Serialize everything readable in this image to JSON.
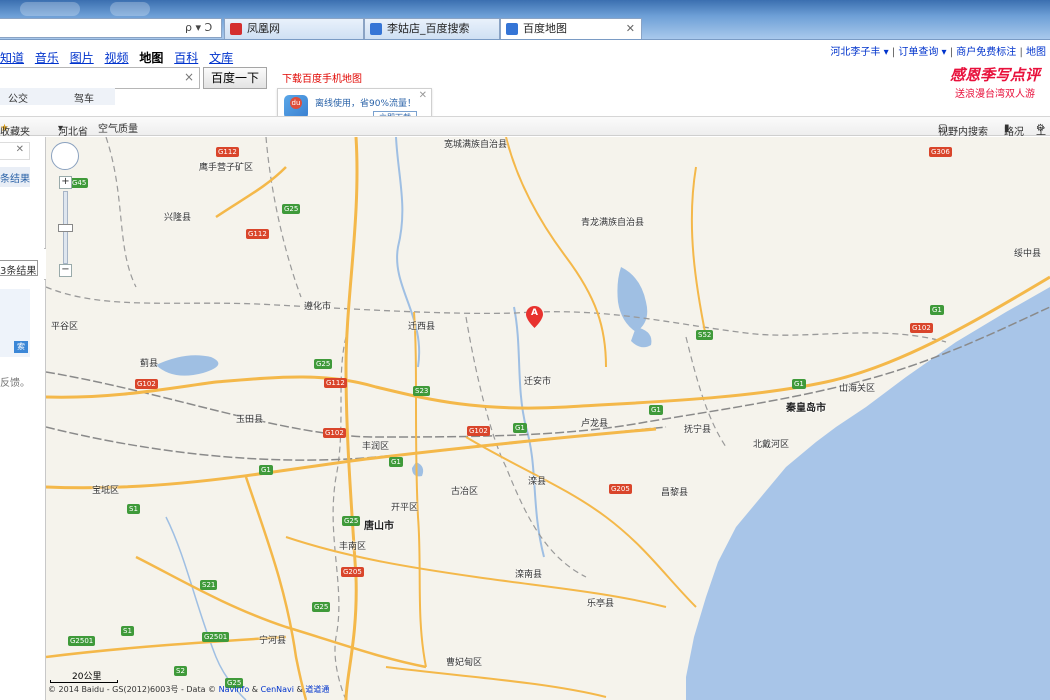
{
  "browser": {
    "address_glyphs": "ρ ▾ Ͻ",
    "tabs": [
      {
        "label": "凤凰网",
        "favicon_color": "#d42e2e"
      },
      {
        "label": "李姑店_百度搜索",
        "favicon_color": "#3575d6"
      },
      {
        "label": "百度地图",
        "favicon_color": "#3575d6"
      }
    ],
    "tab_close": "✕"
  },
  "header": {
    "nav": {
      "links": [
        "知道",
        "音乐",
        "图片",
        "视频"
      ],
      "current": "地图",
      "links_after": [
        "百科",
        "文库"
      ]
    },
    "top_right": {
      "user": "河北李子丰",
      "order": "订单查询",
      "merchant": "商户免费标注",
      "map": "地图"
    },
    "search": {
      "clear": "×",
      "button": "百度一下"
    },
    "download_mobile": "下载百度手机地图",
    "modes": [
      "公交",
      "驾车"
    ],
    "promo": {
      "badge": "du",
      "text": "离线使用，省90%流量！",
      "button": "立即下载",
      "close": "✕"
    },
    "banner": {
      "line1": "感恩季写点评",
      "line2": "送浪漫台湾双人游"
    }
  },
  "toolbar": {
    "favorites": "收藏夹",
    "region": "河北省",
    "air_quality": "空气质量",
    "search_in_view": "视野内搜索",
    "traffic": "路况",
    "tools": "工"
  },
  "left_panel": {
    "close": "✕",
    "result_text": "条结果",
    "result_text2": "3条结果",
    "go": "索",
    "feedback": "反馈。",
    "collapse": "‹"
  },
  "map": {
    "marker_label": "A",
    "scale_label": "20公里",
    "copyright": "© 2014 Baidu - GS(2012)6003号 - Data ©",
    "copyright_link1": "Navinfo",
    "copyright_mid": "&",
    "copyright_link2": "CenNavi",
    "copyright_mid2": "&",
    "copyright_link3": "道道通",
    "colors": {
      "land": "#f5f3ec",
      "sea": "#a8c5e8",
      "highway": "#f4b84a",
      "boundary": "#9a9a9a",
      "water": "#9fbfe3"
    },
    "places": [
      {
        "name": "宽城满族自治县",
        "big": false
      },
      {
        "name": "鹰手营子矿区",
        "big": false
      },
      {
        "name": "兴隆县",
        "big": false
      },
      {
        "name": "青龙满族自治县",
        "big": false
      },
      {
        "name": "平谷区",
        "big": false
      },
      {
        "name": "遵化市",
        "big": false
      },
      {
        "name": "迁西县",
        "big": false
      },
      {
        "name": "蓟县",
        "big": false
      },
      {
        "name": "迁安市",
        "big": false
      },
      {
        "name": "玉田县",
        "big": false
      },
      {
        "name": "丰润区",
        "big": false
      },
      {
        "name": "卢龙县",
        "big": false
      },
      {
        "name": "抚宁县",
        "big": false
      },
      {
        "name": "秦皇岛市",
        "big": true
      },
      {
        "name": "山海关区",
        "big": false
      },
      {
        "name": "北戴河区",
        "big": false
      },
      {
        "name": "绥中县",
        "big": false
      },
      {
        "name": "宝坻区",
        "big": false
      },
      {
        "name": "开平区",
        "big": false
      },
      {
        "name": "古冶区",
        "big": false
      },
      {
        "name": "滦县",
        "big": false
      },
      {
        "name": "昌黎县",
        "big": false
      },
      {
        "name": "唐山市",
        "big": true
      },
      {
        "name": "丰南区",
        "big": false
      },
      {
        "name": "滦南县",
        "big": false
      },
      {
        "name": "乐亭县",
        "big": false
      },
      {
        "name": "宁河县",
        "big": false
      },
      {
        "name": "曹妃甸区",
        "big": false
      }
    ],
    "shields": [
      {
        "name": "G112",
        "national": true
      },
      {
        "name": "G25",
        "national": false
      },
      {
        "name": "G112",
        "national": true
      },
      {
        "name": "G306",
        "national": true
      },
      {
        "name": "G45",
        "national": false
      },
      {
        "name": "S52",
        "national": false
      },
      {
        "name": "G1",
        "national": false
      },
      {
        "name": "G102",
        "national": true
      },
      {
        "name": "G25",
        "national": false
      },
      {
        "name": "G112",
        "national": true
      },
      {
        "name": "S23",
        "national": false
      },
      {
        "name": "G102",
        "national": true
      },
      {
        "name": "G1",
        "national": false
      },
      {
        "name": "G1",
        "national": false
      },
      {
        "name": "G102",
        "national": true
      },
      {
        "name": "G1",
        "national": false
      },
      {
        "name": "G102",
        "national": true
      },
      {
        "name": "G1",
        "national": false
      },
      {
        "name": "G1",
        "national": false
      },
      {
        "name": "G205",
        "national": true
      },
      {
        "name": "S1",
        "national": false
      },
      {
        "name": "G25",
        "national": false
      },
      {
        "name": "G205",
        "national": true
      },
      {
        "name": "S21",
        "national": false
      },
      {
        "name": "G25",
        "national": false
      },
      {
        "name": "S1",
        "national": false
      },
      {
        "name": "G2501",
        "national": false
      },
      {
        "name": "G2501",
        "national": false
      },
      {
        "name": "S2",
        "national": false
      },
      {
        "name": "G25",
        "national": false
      }
    ]
  }
}
